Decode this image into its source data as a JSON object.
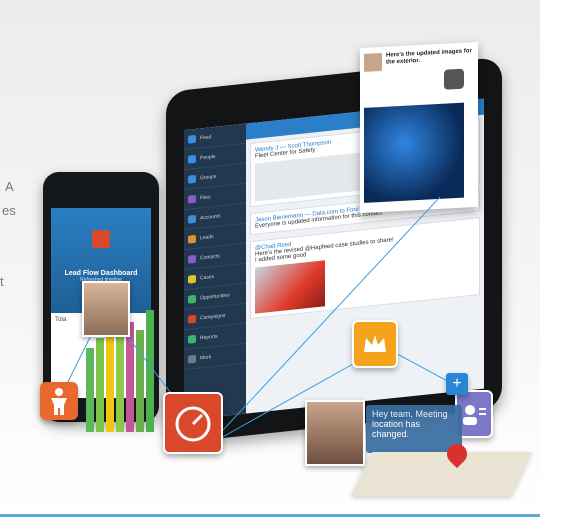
{
  "left_text": {
    "fragment_a": "A",
    "fragment_es": "es",
    "fragment_t": "t"
  },
  "phone": {
    "title": "Lead Flow Dashboard",
    "subtitle": "Refreshed timeline",
    "row_label": "Tota"
  },
  "tablet": {
    "nav_items": [
      "Feed",
      "People",
      "Groups",
      "Files",
      "Accounts",
      "Leads",
      "Contacts",
      "Cases",
      "Opportunities",
      "Campaigns",
      "Reports",
      "More"
    ],
    "posts": [
      {
        "author": "Wendy J — Scott Thompson",
        "text": "Fleet Center for Safety"
      },
      {
        "author": "Jason Bienemann — Data.com to Ford",
        "text": "Everyone is updated information for this contact."
      },
      {
        "author": "@Chad Reed",
        "text": "Here's the revised @Hapfeed case studies to share!",
        "extra": "I added some good"
      }
    ]
  },
  "card": {
    "text": "Here's the updated images for the exterior."
  },
  "bubble": {
    "text": "Hey team, Meeting location has changed."
  },
  "colors": {
    "accent": "#2a7fc8",
    "orange": "#e8682d",
    "red": "#d9482b",
    "gold": "#f3a21a",
    "purple": "#7d77c9"
  }
}
